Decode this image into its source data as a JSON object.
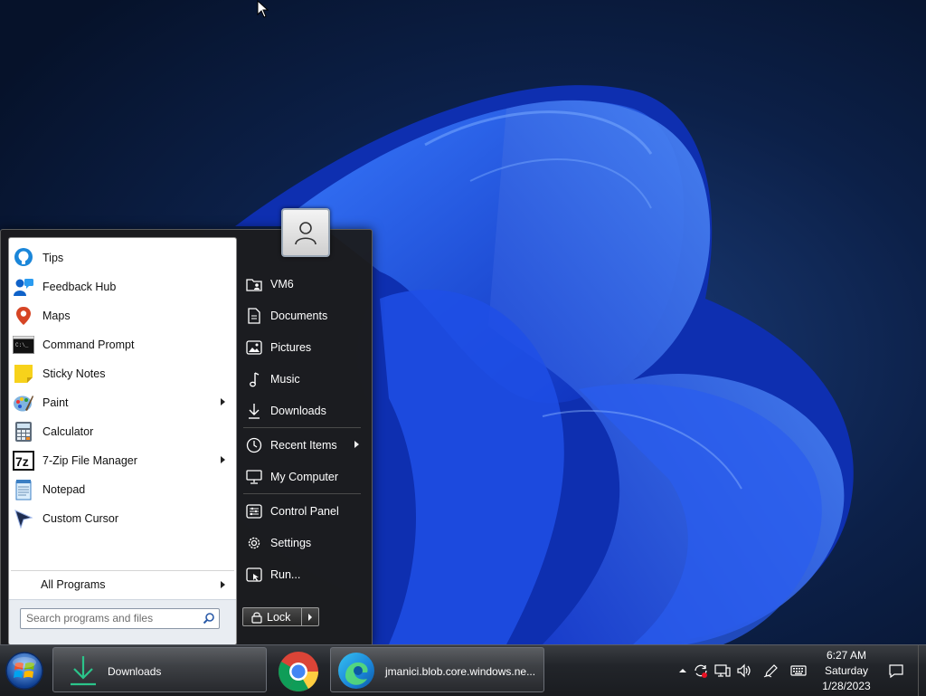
{
  "start_menu": {
    "programs": [
      {
        "label": "Tips",
        "icon": "tips-icon",
        "has_submenu": false
      },
      {
        "label": "Feedback Hub",
        "icon": "feedback-hub-icon",
        "has_submenu": false
      },
      {
        "label": "Maps",
        "icon": "maps-icon",
        "has_submenu": false
      },
      {
        "label": "Command Prompt",
        "icon": "command-prompt-icon",
        "has_submenu": false
      },
      {
        "label": "Sticky Notes",
        "icon": "sticky-notes-icon",
        "has_submenu": false
      },
      {
        "label": "Paint",
        "icon": "paint-icon",
        "has_submenu": true
      },
      {
        "label": "Calculator",
        "icon": "calculator-icon",
        "has_submenu": false
      },
      {
        "label": "7-Zip File Manager",
        "icon": "7zip-icon",
        "has_submenu": true
      },
      {
        "label": "Notepad",
        "icon": "notepad-icon",
        "has_submenu": false
      },
      {
        "label": "Custom Cursor",
        "icon": "custom-cursor-icon",
        "has_submenu": false
      }
    ],
    "all_programs_label": "All Programs",
    "search_placeholder": "Search programs and files",
    "places": [
      {
        "label": "VM6",
        "icon": "user-folder-icon"
      },
      {
        "label": "Documents",
        "icon": "document-icon"
      },
      {
        "label": "Pictures",
        "icon": "picture-icon"
      },
      {
        "label": "Music",
        "icon": "music-note-icon"
      },
      {
        "label": "Downloads",
        "icon": "download-arrow-icon"
      },
      {
        "label": "Recent Items",
        "icon": "clock-icon",
        "has_submenu": true
      },
      {
        "label": "My Computer",
        "icon": "computer-icon"
      },
      {
        "label": "Control Panel",
        "icon": "control-panel-icon"
      },
      {
        "label": "Settings",
        "icon": "gear-icon"
      },
      {
        "label": "Run...",
        "icon": "run-icon"
      }
    ],
    "lock_label": "Lock"
  },
  "taskbar": {
    "buttons": [
      {
        "label": "Downloads",
        "icon": "download-arrow-icon"
      },
      {
        "label": "",
        "icon": "chrome-icon"
      },
      {
        "label": "jmanici.blob.core.windows.ne...",
        "icon": "edge-icon"
      }
    ],
    "clock": {
      "time": "6:27 AM",
      "day": "Saturday",
      "date": "1/28/2023"
    },
    "tray_icons": [
      "chevron-up-icon",
      "sync-alert-icon",
      "network-icon",
      "volume-icon",
      "pen-icon",
      "keyboard-icon",
      "notification-icon"
    ]
  },
  "colors": {
    "accent": "#1f4fd8",
    "menu_bg": "#1c1c1e",
    "taskbar_bg": "#22252a"
  }
}
